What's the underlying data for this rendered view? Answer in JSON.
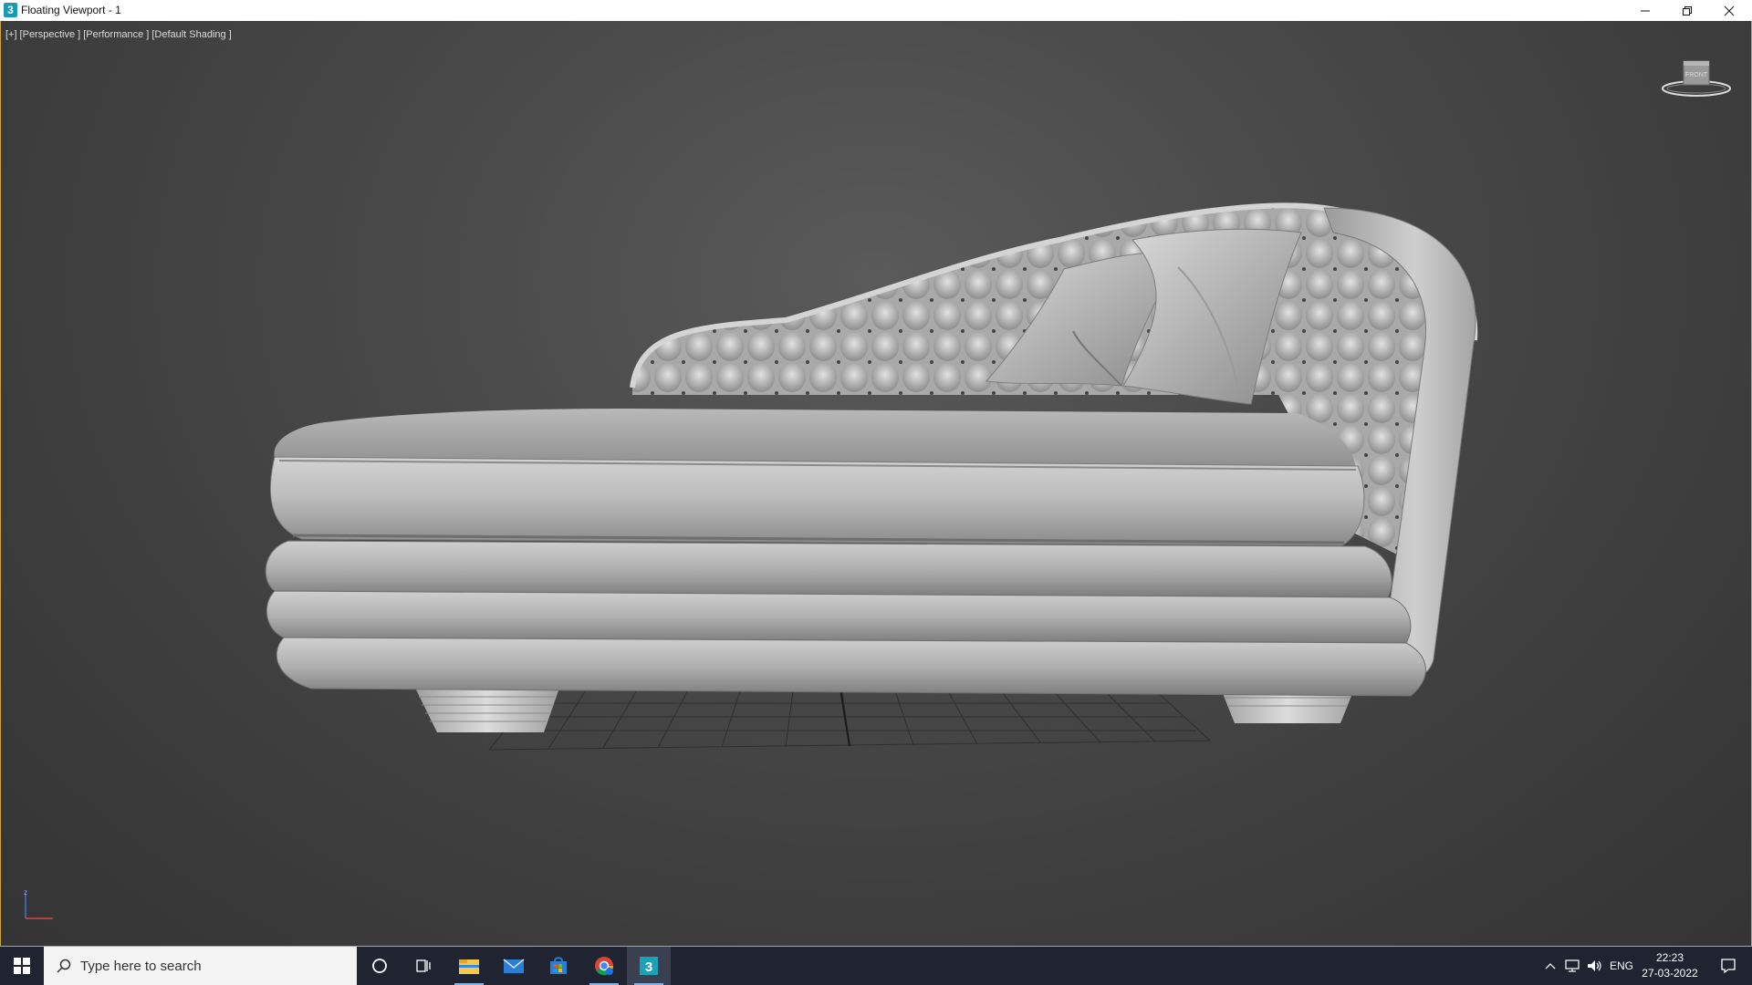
{
  "window": {
    "title": "Floating Viewport - 1",
    "app_icon_glyph": "3"
  },
  "viewport": {
    "labels": [
      "[+]",
      "[Perspective ]",
      "[Performance ]",
      "[Default Shading ]"
    ],
    "viewcube_face": "FRONT",
    "axis": {
      "z_label": "z"
    },
    "object": "tufted chaise longue"
  },
  "taskbar": {
    "search_placeholder": "Type here to search",
    "pinned": [
      "cortana-icon",
      "task-view-icon",
      "file-explorer-icon",
      "mail-icon",
      "store-icon",
      "chrome-icon",
      "3dsmax-icon"
    ],
    "active_app": "3dsmax-icon",
    "tray": {
      "language": "ENG",
      "time": "22:23",
      "date": "27-03-2022"
    }
  },
  "colors": {
    "viewport_border": "#c9a440",
    "taskbar_bg": "#1f2430",
    "accent": "#7fb3e8"
  }
}
